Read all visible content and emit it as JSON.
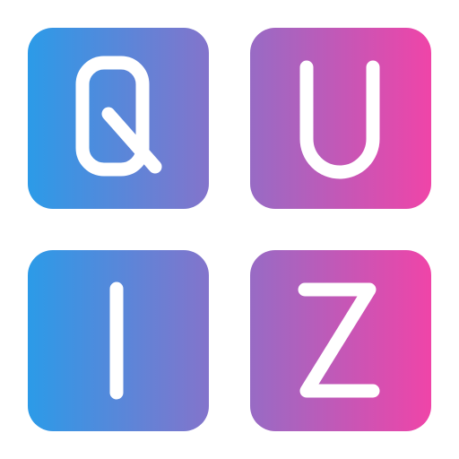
{
  "tiles": [
    {
      "letter": "Q",
      "icon": "letter-q-icon"
    },
    {
      "letter": "U",
      "icon": "letter-u-icon"
    },
    {
      "letter": "I",
      "icon": "letter-i-icon"
    },
    {
      "letter": "Z",
      "icon": "letter-z-icon"
    }
  ],
  "colors": {
    "gradient_start": "#2b9be8",
    "gradient_end": "#f044a8",
    "glyph_stroke": "#ffffff",
    "background": "#ffffff"
  }
}
